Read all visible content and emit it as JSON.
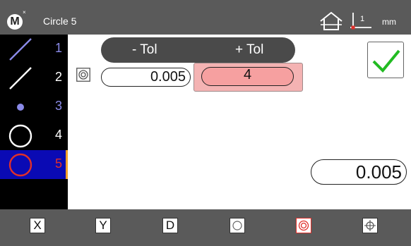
{
  "header": {
    "logo_text": "M",
    "logo_mark": "×",
    "title": "Circle 5",
    "units": "mm",
    "home_icon": "home-icon",
    "datum_icon": "datum-icon",
    "datum_label": "1",
    "datum_marker_color": "#e0302a"
  },
  "sidebar": {
    "features": [
      {
        "number": "1",
        "icon": "line-icon",
        "color": "#8a8ae8"
      },
      {
        "number": "2",
        "icon": "line-icon",
        "color": "#ffffff"
      },
      {
        "number": "3",
        "icon": "point-icon",
        "color": "#8a8ae8"
      },
      {
        "number": "4",
        "icon": "circle-icon",
        "color": "#ffffff"
      },
      {
        "number": "5",
        "icon": "circle-icon",
        "color": "#e0302a",
        "selected": true
      }
    ]
  },
  "tolerance": {
    "minus_label": "- Tol",
    "plus_label": "+ Tol",
    "type_icon": "concentricity-icon",
    "minus_value": "0.005",
    "plus_value": "4",
    "active_field_color": "#f6a0a0"
  },
  "actions": {
    "ok_icon": "checkmark-icon",
    "ok_color": "#22bb22"
  },
  "result": {
    "value": "0.005"
  },
  "bottom_toolbar": {
    "buttons": [
      {
        "label": "X"
      },
      {
        "label": "Y"
      },
      {
        "label": "D"
      },
      {
        "icon": "circle-icon"
      },
      {
        "icon": "concentricity-icon",
        "active": true
      },
      {
        "icon": "crosshair-icon"
      }
    ]
  }
}
